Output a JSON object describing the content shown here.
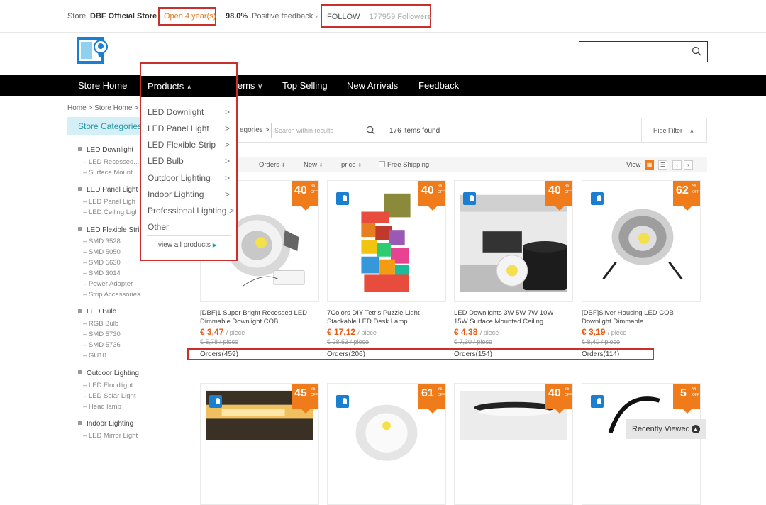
{
  "topbar": {
    "store_label": "Store",
    "store_name": "DBF Official Store",
    "open_years": "Open 4 year(s)",
    "feedback_pct": "98.0%",
    "feedback_label": "Positive feedback",
    "follow_label": "FOLLOW",
    "followers": "177959 Followers"
  },
  "nav": [
    "Store Home",
    "Products",
    "Sale Items",
    "Top Selling",
    "New Arrivals",
    "Feedback"
  ],
  "dropdown": {
    "items": [
      "LED Downlight",
      "LED Panel Light",
      "LED Flexible Strip",
      "LED Bulb",
      "Outdoor Lighting",
      "Indoor Lighting",
      "Professional Lighting",
      "Other"
    ],
    "view_all": "view all products"
  },
  "breadcrumb": "Home > Store Home >",
  "store_categories": "Store Categories",
  "sidebar": {
    "cats": [
      {
        "name": "LED Downlight",
        "subs": [
          "LED Recessed...",
          "Surface Mount"
        ]
      },
      {
        "name": "LED Panel Light",
        "subs": [
          "LED Panel Ligh",
          "LED Ceiling Ligh"
        ]
      },
      {
        "name": "LED Flexible Stri",
        "subs": [
          "SMD 3528",
          "SMD 5050",
          "SMD 5630",
          "SMD 3014",
          "Power Adapter",
          "Strip Accessories"
        ]
      },
      {
        "name": "LED Bulb",
        "subs": [
          "RGB Bulb",
          "SMD 5730",
          "SMD 5736",
          "GU10"
        ]
      },
      {
        "name": "Outdoor Lighting",
        "subs": [
          "LED Floodlight",
          "LED Solar Light",
          "Head lamp"
        ]
      },
      {
        "name": "Indoor Lighting",
        "subs": [
          "LED Mirror Light"
        ]
      }
    ]
  },
  "filter": {
    "categories": "egories >",
    "search_placeholder": "Search within results",
    "count": "176 items found",
    "hide_filter": "Hide Filter"
  },
  "sort": {
    "orders": "Orders",
    "new": "New",
    "price": "price",
    "free_shipping": "Free Shipping",
    "view": "View"
  },
  "products": [
    {
      "discount": "40",
      "title": "[DBF]1 Super Bright Recessed LED Dimmable Downlight COB...",
      "price": "€ 3,47",
      "unit": "/ piece",
      "orig": "€ 5,78 / piece",
      "orders": "Orders(459)"
    },
    {
      "discount": "40",
      "title": "7Colors DIY Tetris Puzzle Light Stackable LED Desk Lamp...",
      "price": "€ 17,12",
      "unit": "/ piece",
      "orig": "€ 28,53 / piece",
      "orders": "Orders(206)"
    },
    {
      "discount": "40",
      "title": "LED Downlights 3W 5W 7W 10W 15W Surface Mounted Ceiling...",
      "price": "€ 4,38",
      "unit": "/ piece",
      "orig": "€ 7,30 / piece",
      "orders": "Orders(154)"
    },
    {
      "discount": "62",
      "title": "[DBF]Silver Housing LED COB Downlight Dimmable...",
      "price": "€ 3,19",
      "unit": "/ piece",
      "orig": "€ 8,40 / piece",
      "orders": "Orders(114)"
    }
  ],
  "row2_discounts": [
    "45",
    "61",
    "40",
    "5"
  ],
  "badge_pct": "%",
  "badge_off": "OFF",
  "recently_viewed": "Recently Viewed",
  "colors": {
    "accent": "#f07b1a",
    "highlight": "#c9302c",
    "nav_bg": "#000000",
    "price": "#e65a12"
  }
}
